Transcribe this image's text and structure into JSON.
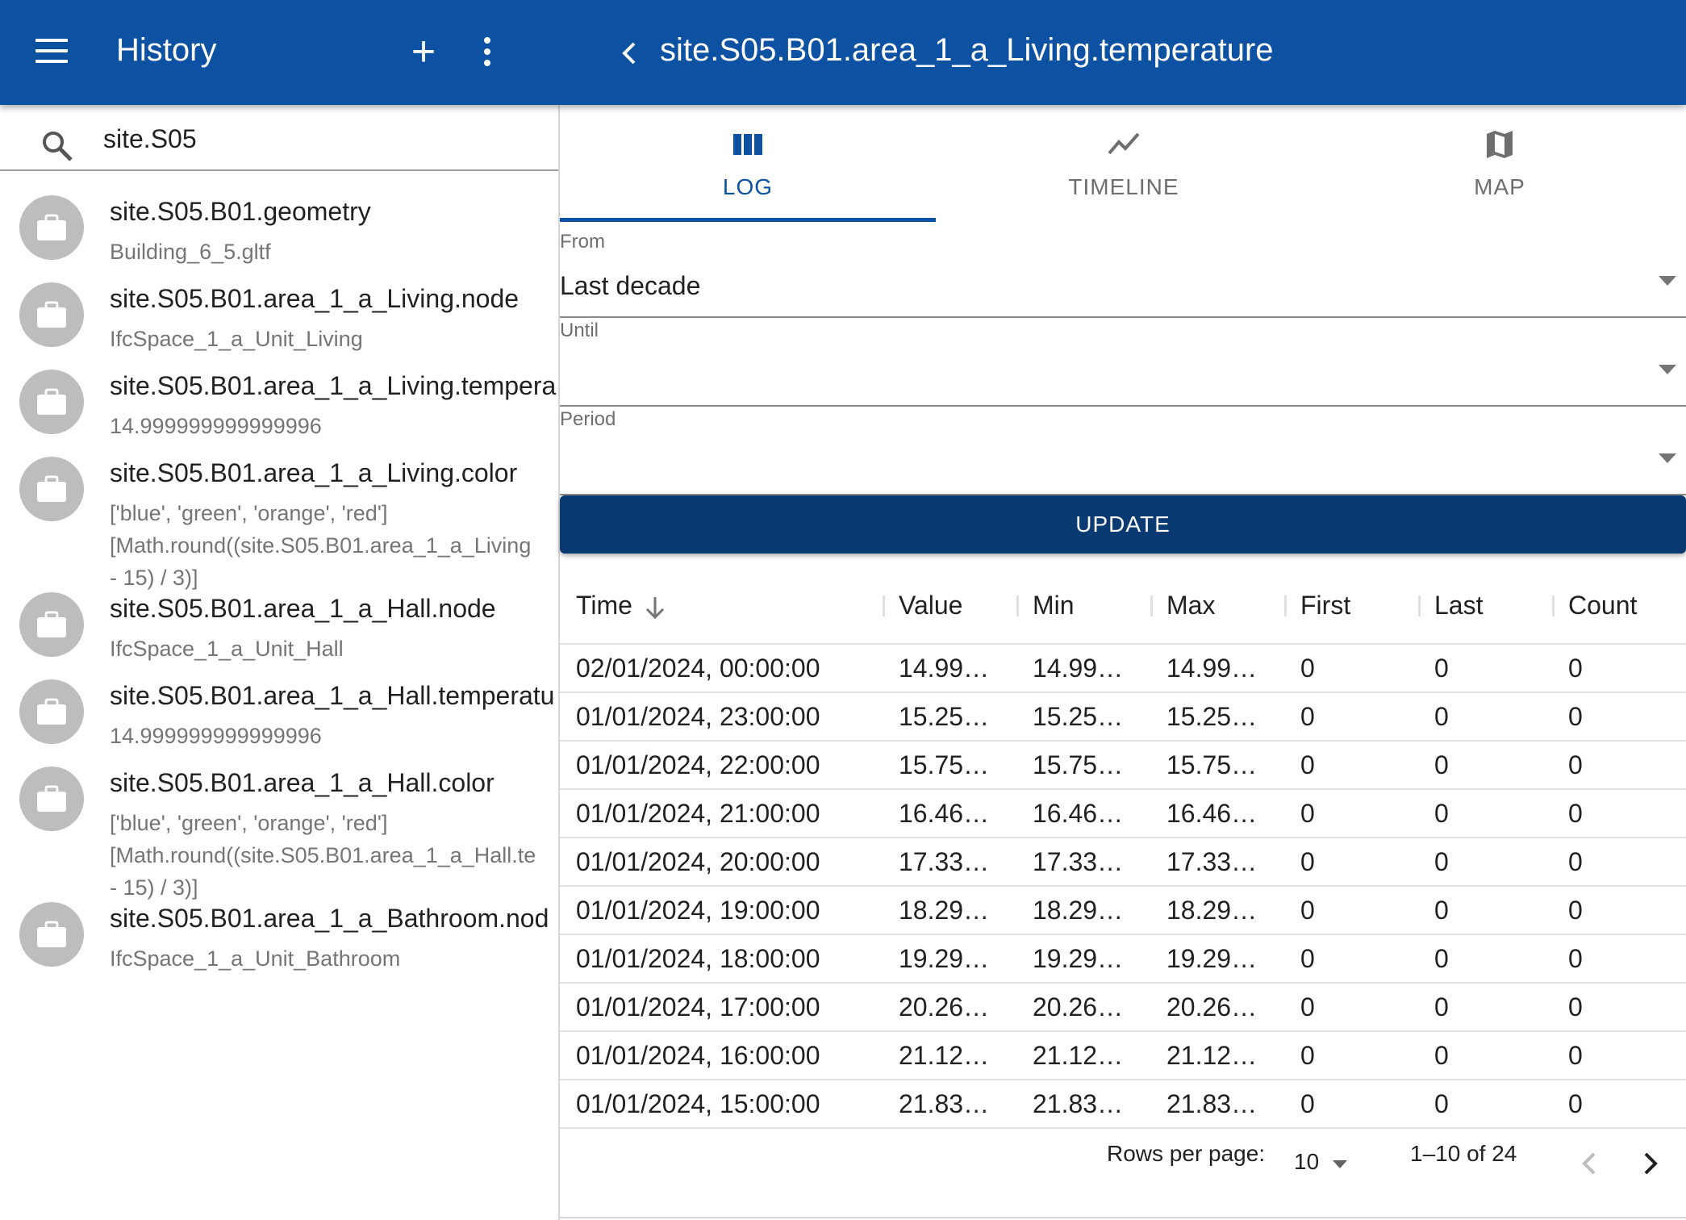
{
  "appbar": {
    "title": "History",
    "detail_title": "site.S05.B01.area_1_a_Living.temperature"
  },
  "search": {
    "value": "site.S05"
  },
  "list": {
    "items": [
      {
        "primary": "site.S05.B01.geometry",
        "secondary": "Building_6_5.gltf"
      },
      {
        "primary": "site.S05.B01.area_1_a_Living.node",
        "secondary": "IfcSpace_1_a_Unit_Living"
      },
      {
        "primary": "site.S05.B01.area_1_a_Living.tempera",
        "secondary": "14.999999999999996"
      },
      {
        "primary": "site.S05.B01.area_1_a_Living.color",
        "secondary": "['blue', 'green', 'orange', 'red']\n[Math.round((site.S05.B01.area_1_a_Living\n- 15) / 3)]"
      },
      {
        "primary": "site.S05.B01.area_1_a_Hall.node",
        "secondary": "IfcSpace_1_a_Unit_Hall"
      },
      {
        "primary": "site.S05.B01.area_1_a_Hall.temperatu",
        "secondary": "14.999999999999996"
      },
      {
        "primary": "site.S05.B01.area_1_a_Hall.color",
        "secondary": "['blue', 'green', 'orange', 'red']\n[Math.round((site.S05.B01.area_1_a_Hall.te\n- 15) / 3)]"
      },
      {
        "primary": "site.S05.B01.area_1_a_Bathroom.nod",
        "secondary": "IfcSpace_1_a_Unit_Bathroom"
      }
    ]
  },
  "tabs": [
    {
      "label": "LOG",
      "icon": "column-icon",
      "active": true
    },
    {
      "label": "TIMELINE",
      "icon": "timeline-icon",
      "active": false
    },
    {
      "label": "MAP",
      "icon": "map-icon",
      "active": false
    }
  ],
  "form": {
    "from_label": "From",
    "from_value": "Last decade",
    "until_label": "Until",
    "until_value": "",
    "period_label": "Period",
    "period_value": "",
    "update_label": "UPDATE"
  },
  "table": {
    "columns": [
      "Time",
      "Value",
      "Min",
      "Max",
      "First",
      "Last",
      "Count"
    ],
    "rows": [
      [
        "02/01/2024, 00:00:00",
        "14.99…",
        "14.99…",
        "14.99…",
        "0",
        "0",
        "0"
      ],
      [
        "01/01/2024, 23:00:00",
        "15.25…",
        "15.25…",
        "15.25…",
        "0",
        "0",
        "0"
      ],
      [
        "01/01/2024, 22:00:00",
        "15.75…",
        "15.75…",
        "15.75…",
        "0",
        "0",
        "0"
      ],
      [
        "01/01/2024, 21:00:00",
        "16.46…",
        "16.46…",
        "16.46…",
        "0",
        "0",
        "0"
      ],
      [
        "01/01/2024, 20:00:00",
        "17.33…",
        "17.33…",
        "17.33…",
        "0",
        "0",
        "0"
      ],
      [
        "01/01/2024, 19:00:00",
        "18.29…",
        "18.29…",
        "18.29…",
        "0",
        "0",
        "0"
      ],
      [
        "01/01/2024, 18:00:00",
        "19.29…",
        "19.29…",
        "19.29…",
        "0",
        "0",
        "0"
      ],
      [
        "01/01/2024, 17:00:00",
        "20.26…",
        "20.26…",
        "20.26…",
        "0",
        "0",
        "0"
      ],
      [
        "01/01/2024, 16:00:00",
        "21.12…",
        "21.12…",
        "21.12…",
        "0",
        "0",
        "0"
      ],
      [
        "01/01/2024, 15:00:00",
        "21.83…",
        "21.83…",
        "21.83…",
        "0",
        "0",
        "0"
      ]
    ]
  },
  "pagination": {
    "rows_per_page_label": "Rows per page:",
    "rows_per_page_value": "10",
    "range": "1–10 of 24"
  },
  "colors": {
    "appbar": "#0d51a3",
    "update_button": "#0a3a72",
    "avatar": "#bdbdbd"
  }
}
